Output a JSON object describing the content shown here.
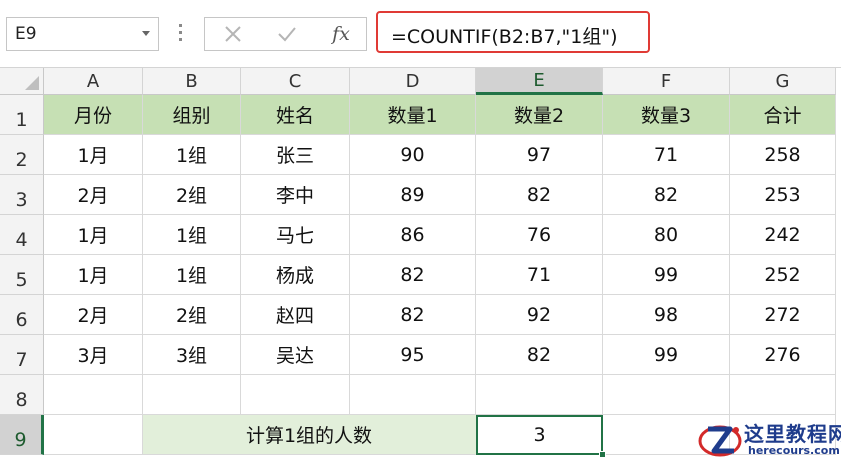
{
  "formula_bar": {
    "name_box": "E9",
    "cancel_icon": "x-icon",
    "enter_icon": "check-icon",
    "function_label": "fx",
    "formula": "=COUNTIF(B2:B7,\"1组\")"
  },
  "sheet": {
    "columns": [
      "A",
      "B",
      "C",
      "D",
      "E",
      "F",
      "G"
    ],
    "selected_column": "E",
    "rows": [
      "1",
      "2",
      "3",
      "4",
      "5",
      "6",
      "7",
      "8",
      "9"
    ],
    "selected_row": "9",
    "header": [
      "月份",
      "组别",
      "姓名",
      "数量1",
      "数量2",
      "数量3",
      "合计"
    ],
    "data": [
      [
        "1月",
        "1组",
        "张三",
        "90",
        "97",
        "71",
        "258"
      ],
      [
        "2月",
        "2组",
        "李中",
        "89",
        "82",
        "82",
        "253"
      ],
      [
        "1月",
        "1组",
        "马七",
        "86",
        "76",
        "80",
        "242"
      ],
      [
        "1月",
        "1组",
        "杨成",
        "82",
        "71",
        "99",
        "252"
      ],
      [
        "2月",
        "2组",
        "赵四",
        "82",
        "92",
        "98",
        "272"
      ],
      [
        "3月",
        "3组",
        "吴达",
        "95",
        "82",
        "99",
        "276"
      ]
    ],
    "summary_label": "计算1组的人数",
    "summary_value": "3"
  },
  "colors": {
    "header_fill": "#c6e0b4",
    "summary_fill": "#e2efda",
    "selection": "#217346",
    "formula_highlight": "#e03a35"
  },
  "watermark": {
    "name": "这里教程网",
    "url": "herecours.com"
  }
}
